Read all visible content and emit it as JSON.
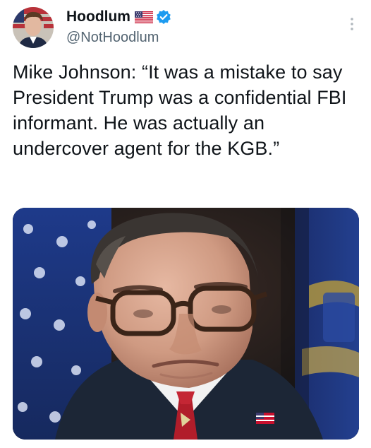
{
  "post": {
    "display_name": "Hoodlum",
    "handle": "@NotHoodlum",
    "text": "Mike Johnson: “It was a mistake to say President Trump was a confidential FBI informant. He was actually an undercover agent for the KGB.”",
    "flag_icon": "us-flag-icon",
    "verified_icon": "verified-badge-icon",
    "more_icon": "more-options-icon"
  },
  "colors": {
    "text": "#0f1419",
    "handle": "#536471",
    "verified": "#1d9bf0"
  }
}
